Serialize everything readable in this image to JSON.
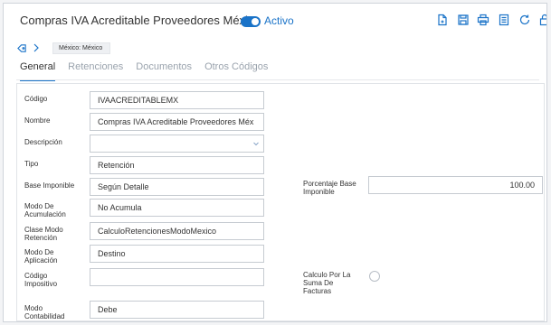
{
  "header": {
    "title": "Compras IVA Acreditable Proveedores México",
    "status_label": "Activo",
    "accent_color": "#1a73c8",
    "toolbar_icons": [
      "new-document-icon",
      "save-icon",
      "print-icon",
      "list-icon",
      "refresh-icon",
      "lock-icon"
    ]
  },
  "breadcrumb": {
    "chip": "México: México"
  },
  "tabs": [
    {
      "label": "General"
    },
    {
      "label": "Retenciones"
    },
    {
      "label": "Documentos"
    },
    {
      "label": "Otros Códigos"
    }
  ],
  "form": {
    "codigo": {
      "label": "Código",
      "value": "IVAACREDITABLEMX"
    },
    "nombre": {
      "label": "Nombre",
      "value": "Compras IVA Acreditable Proveedores Méx"
    },
    "descripcion": {
      "label": "Descripción",
      "value": ""
    },
    "tipo": {
      "label": "Tipo",
      "value": "Retención"
    },
    "base_imponible": {
      "label": "Base Imponible",
      "value": "Según Detalle"
    },
    "porcentaje": {
      "label1": "Porcentaje Base",
      "label2": "Imponible",
      "value": "100.00"
    },
    "modo_acumulacion": {
      "label1": "Modo De",
      "label2": "Acumulación",
      "value": "No Acumula"
    },
    "clase_modo_retencion": {
      "label1": "Clase Modo",
      "label2": "Retención",
      "value": "CalculoRetencionesModoMexico"
    },
    "modo_aplicacion": {
      "label1": "Modo De",
      "label2": "Aplicación",
      "value": "Destino"
    },
    "codigo_impositivo": {
      "label1": "Código",
      "label2": "Impositivo",
      "value": ""
    },
    "calculo_suma": {
      "label1": "Calculo Por La",
      "label2": "Suma De",
      "label3": "Facturas",
      "checked": false
    },
    "modo_contabilidad": {
      "label1": "Modo",
      "label2": "Contabilidad",
      "value": "Debe"
    }
  }
}
